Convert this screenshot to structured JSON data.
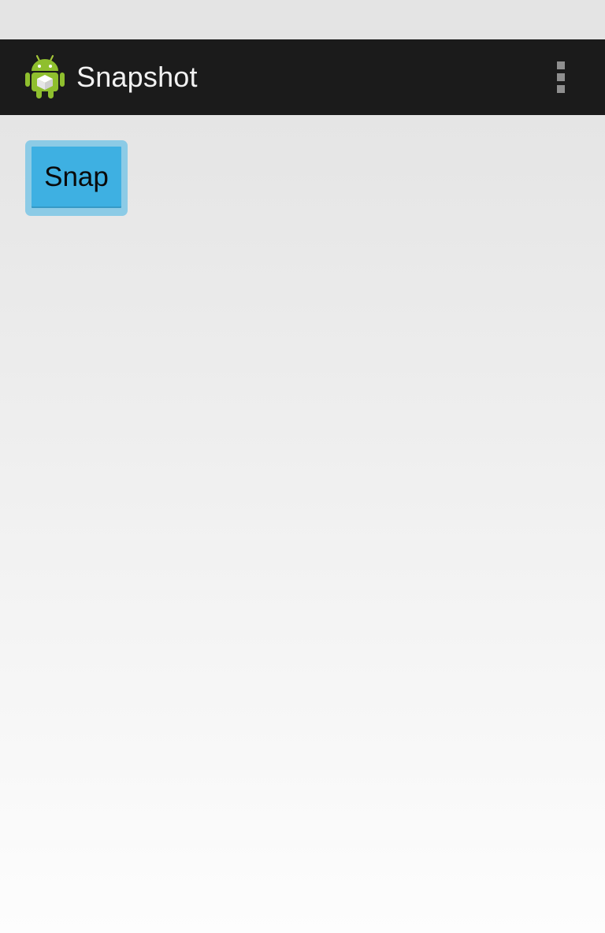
{
  "action_bar": {
    "title": "Snapshot",
    "app_icon": "android-robot-icon",
    "overflow_icon": "overflow-menu-icon"
  },
  "main": {
    "snap_button_label": "Snap"
  },
  "colors": {
    "action_bar_bg": "#1b1b1b",
    "button_bg": "#3eb0e2",
    "button_focus_ring": "#8ccbe6",
    "title_text": "#f2f2f2"
  }
}
